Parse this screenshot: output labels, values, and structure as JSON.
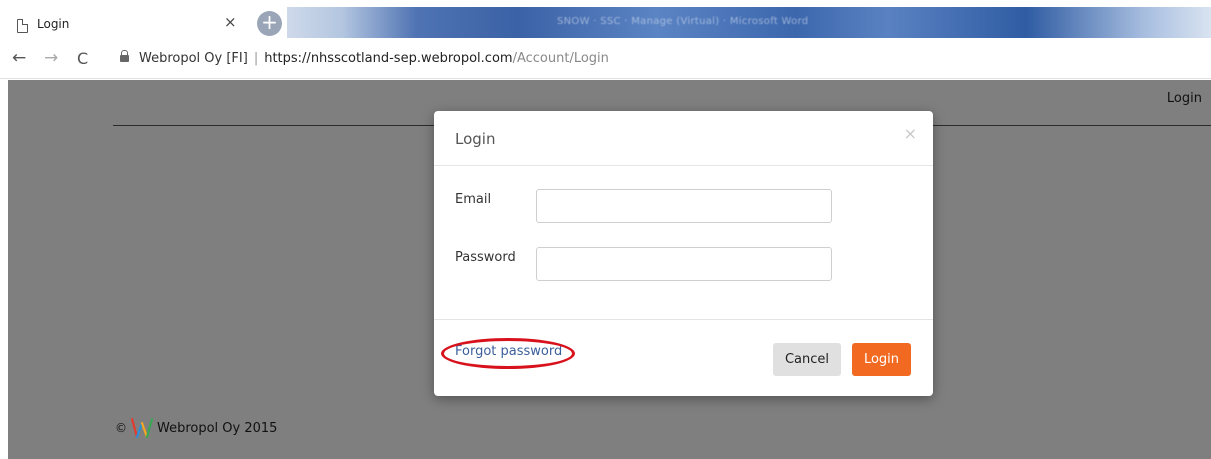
{
  "tab": {
    "title": "Login",
    "close_glyph": "×",
    "new_tab_glyph": "+",
    "icon": "page-icon"
  },
  "window_strip_text": "SNOW · SSC · Manage (Virtual) · Microsoft Word",
  "address_bar": {
    "back_glyph": "←",
    "forward_glyph": "→",
    "reload_glyph": "C",
    "org": "Webropol Oy [FI]",
    "separator": "|",
    "host": "https://nhsscotland-sep.webropol.com",
    "path": "/Account/Login"
  },
  "navbar": {
    "login_link": "Login"
  },
  "modal": {
    "title": "Login",
    "close_glyph": "×",
    "email_label": "Email",
    "email_value": "",
    "password_label": "Password",
    "password_value": "",
    "forgot_password": "Forgot password",
    "cancel_label": "Cancel",
    "login_label": "Login"
  },
  "footer": {
    "copyright_symbol": "©",
    "text": "Webropol Oy 2015"
  },
  "colors": {
    "page_background": "#7f7f7f",
    "login_button": "#f26a21",
    "cancel_button": "#e0e0e0",
    "highlight_annotation": "#d8121c",
    "link": "#3b5f9b"
  }
}
